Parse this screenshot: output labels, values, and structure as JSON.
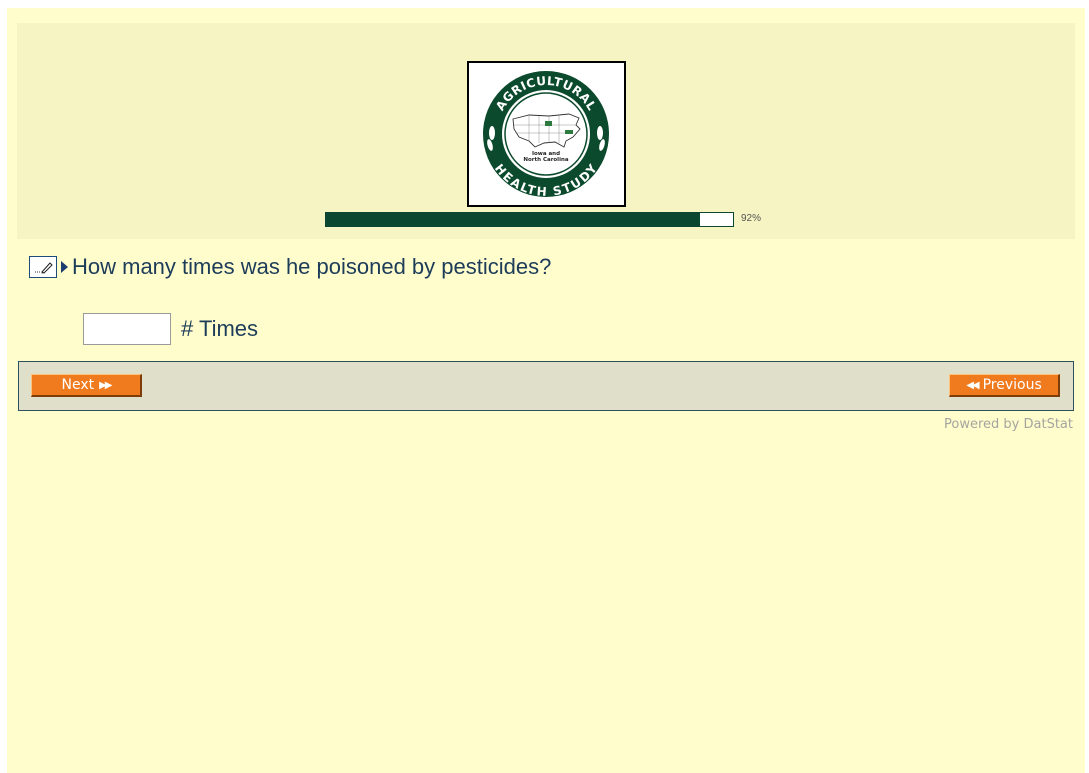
{
  "header": {
    "logo": {
      "top_text": "AGRICULTURAL",
      "bottom_text": "HEALTH STUDY",
      "center_text_1": "Iowa and",
      "center_text_2": "North Carolina"
    },
    "progress": {
      "percent": 92,
      "label": "92%"
    }
  },
  "question": {
    "text": "How many times was he poisoned by pesticides?",
    "answer_value": "",
    "answer_unit": "# Times"
  },
  "nav": {
    "next_label": "Next",
    "previous_label": "Previous"
  },
  "footer": {
    "powered_by": "Powered by DatStat"
  },
  "colors": {
    "page_bg": "#fffdcc",
    "header_bg": "#f6f4c2",
    "progress": "#0b4631",
    "button": "#f07a1e",
    "nav_bg": "#e0dfc9"
  }
}
